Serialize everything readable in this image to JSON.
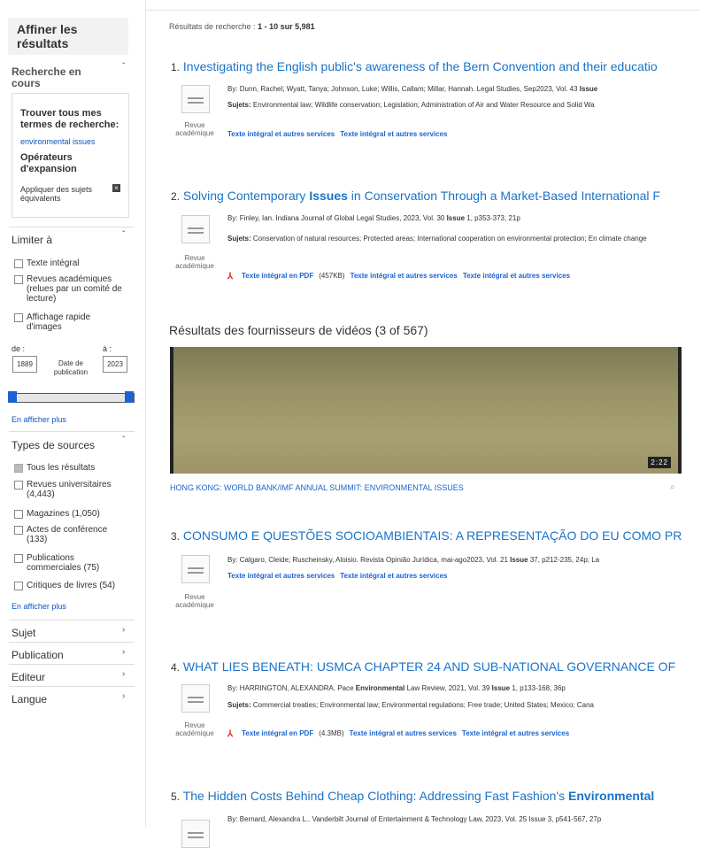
{
  "sidebar": {
    "refine_title": "Affiner les résultats",
    "current_search": "Recherche en cours",
    "find_all_terms": "Trouver tous mes termes de recherche:",
    "search_term": "environmental issues",
    "expanders": "Opérateurs d'expansion",
    "apply_equiv": "Appliquer des sujets équivalents",
    "limit_to": "Limiter à",
    "limits": [
      "Texte intégral",
      "Revues académiques (relues par un comité de lecture)",
      "Affichage rapide d'images"
    ],
    "from_label": "de :",
    "to_label": "à :",
    "date_from": "1889",
    "date_to": "2023",
    "date_label": "Date de publication",
    "show_more": "En afficher plus",
    "source_types": "Types de sources",
    "sources": [
      "Tous les résultats",
      "Revues universitaires (4,443)",
      "Magazines (1,050)",
      "Actes de conférence (133)",
      "Publications commerciales (75)",
      "Critiques de livres (54)"
    ],
    "facets": [
      "Sujet",
      "Publication",
      "Editeur",
      "Langue"
    ]
  },
  "main": {
    "summary_prefix": "Résultats de recherche : ",
    "summary_range": "1 - 10 sur 5,981",
    "doc_type": "Revue académique",
    "full_text_link": "Texte intégral et autres services",
    "pdf_link": "Texte intégral en PDF",
    "subjects_label": "Sujets: ",
    "results": [
      {
        "num": "1.",
        "title": "Investigating the English public's awareness of the Bern Convention and their educatio",
        "by": "By: Dunn, Rachel; Wyatt, Tanya; Johnson, Luke; Willis, Callam; Millar, Hannah. Legal Studies, Sep2023, Vol. 43",
        "by_issue": "Issue",
        "subjects": "Environmental law; Wildlife conservation; Legislation; Administration of Air and Water Resource and Solid Wa"
      },
      {
        "num": "2.",
        "title_pre": "Solving Contemporary ",
        "title_bold": "Issues",
        "title_post": " in Conservation Through a Market-Based International F",
        "by_pre": "By: Finley, Ian. Indiana Journal of Global Legal Studies, 2023, Vol. 30 ",
        "by_issue": "Issue",
        "by_post": " 1, p353-373, 21p",
        "subjects": "Conservation of natural resources; Protected areas; International cooperation on environmental protection; En climate change",
        "pdf_size": "(457KB)"
      },
      {
        "num": "3.",
        "title": "CONSUMO E QUESTÕES SOCIOAMBIENTAIS: A REPRESENTAÇÃO DO EU COMO PR",
        "by_pre": "By: Calgaro, Cleide; Ruscheinsky, Aloisio. Revista Opinião Jurídica, mai-ago2023, Vol. 21 ",
        "by_issue": "Issue",
        "by_post": " 37, p212-235, 24p; La"
      },
      {
        "num": "4.",
        "title": "WHAT LIES BENEATH: USMCA CHAPTER 24 AND SUB-NATIONAL GOVERNANCE OF",
        "by_pre": "By: HARRINGTON, ALEXANDRA. Pace ",
        "by_bold": "Environmental",
        "by_mid": " Law Review, 2021, Vol. 39 ",
        "by_issue": "Issue",
        "by_post": " 1, p133-168, 36p",
        "subjects": "Commercial treaties; Environmental law; Environmental regulations; Free trade; United States; Mexico; Cana",
        "pdf_size": "(4.3MB)"
      },
      {
        "num": "5.",
        "title_pre": "The Hidden Costs Behind Cheap Clothing: Addressing Fast Fashion's ",
        "title_bold": "Environmental",
        "by": "By: Bernard, Alexandra L.. Vanderbilt Journal of Entertainment & Technology Law, 2023, Vol. 25 Issue 3, p541-567, 27p"
      }
    ],
    "video_heading": "Résultats des fournisseurs de vidéos (3 of 567)",
    "video_duration": "2:22",
    "video_caption": "HONG KONG: WORLD BANK/IMF ANNUAL SUMMIT: ENVIRONMENTAL ISSUES"
  }
}
